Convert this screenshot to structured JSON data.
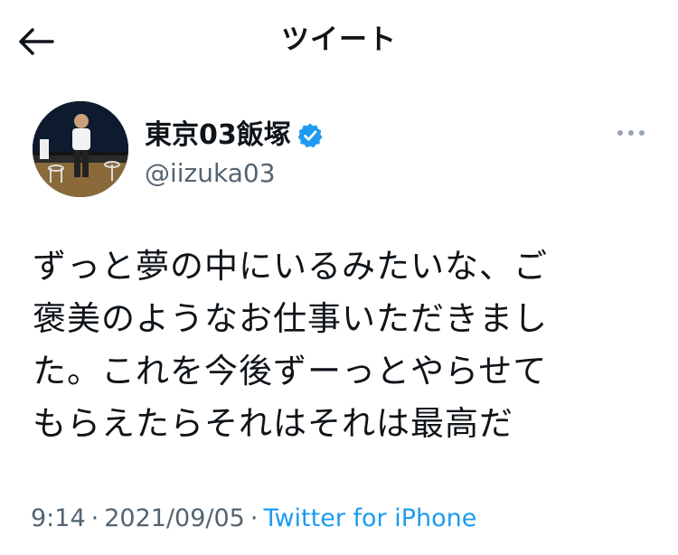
{
  "header": {
    "title": "ツイート"
  },
  "tweet": {
    "display_name": "東京03飯塚",
    "handle": "@iizuka03",
    "text": "ずっと夢の中にいるみたいな、ご\n褒美のようなお仕事いただきまし\nた。これを今後ずーっとやらせて\nもらえたらそれはそれは最高だ",
    "time": "9:14",
    "date": "2021/09/05",
    "separator": "·",
    "source": "Twitter for iPhone"
  },
  "colors": {
    "verified_badge": "#1d9bf0",
    "link": "#1d9bf0",
    "secondary_text": "#536471",
    "primary_text": "#0f1419"
  },
  "icons": {
    "back": "arrow-left-icon",
    "verified": "verified-badge-icon",
    "more": "more-horizontal-icon"
  }
}
